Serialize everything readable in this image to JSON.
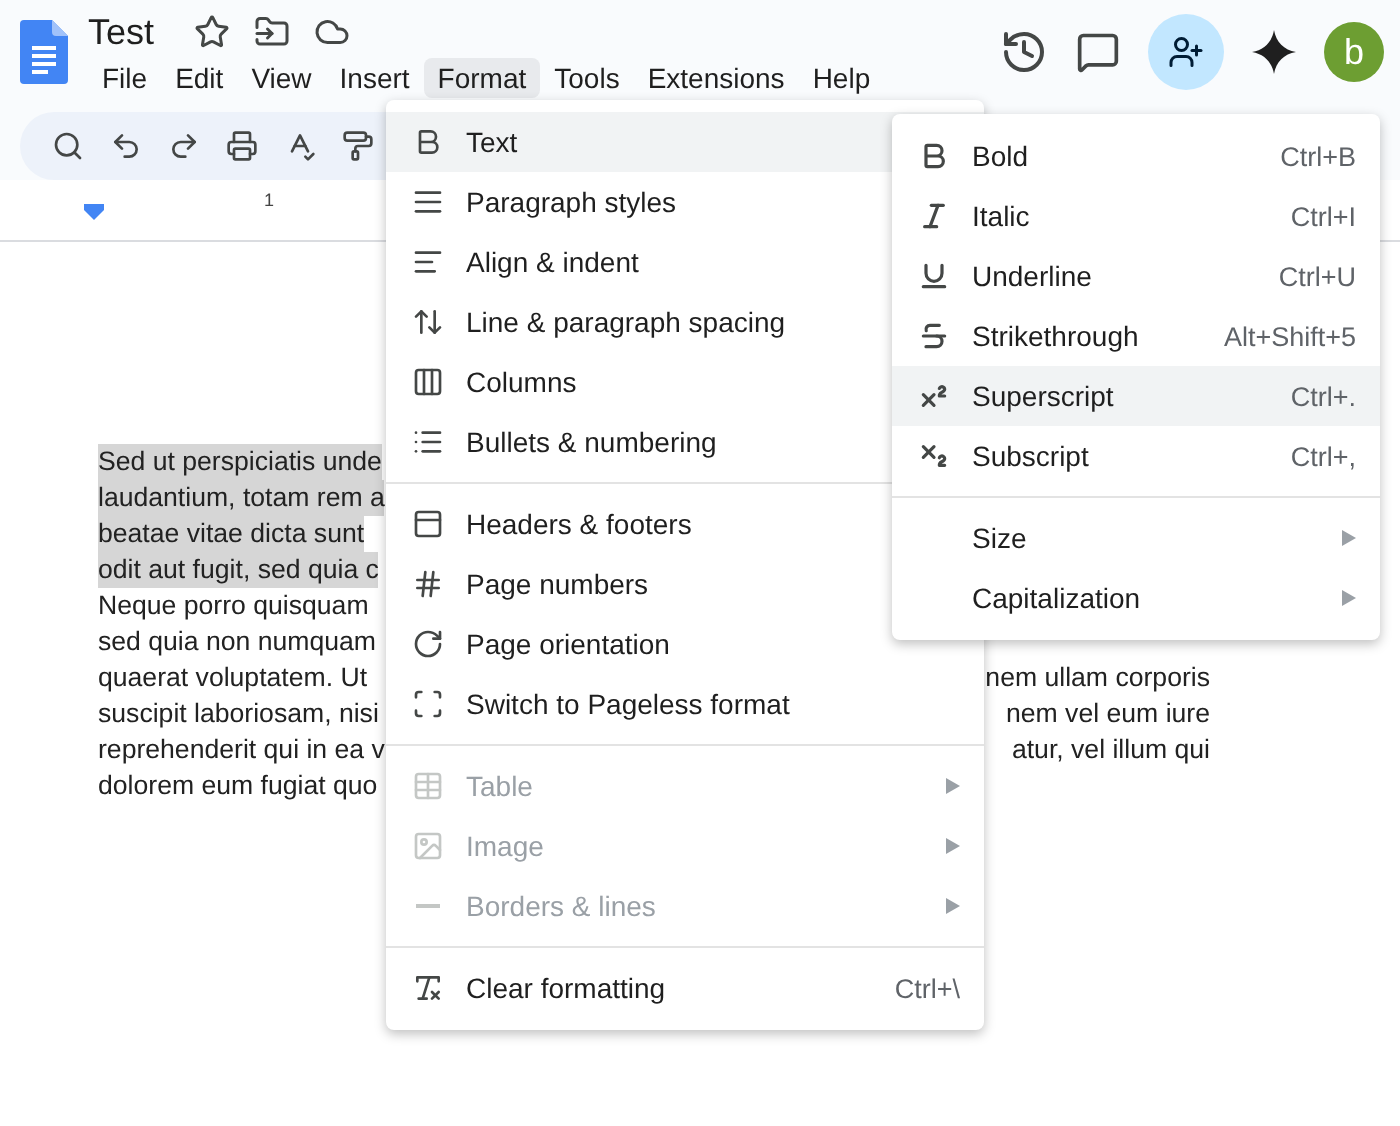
{
  "document": {
    "title": "Test",
    "avatar_letter": "b"
  },
  "menubar": [
    {
      "label": "File",
      "selected": false
    },
    {
      "label": "Edit",
      "selected": false
    },
    {
      "label": "View",
      "selected": false
    },
    {
      "label": "Insert",
      "selected": false
    },
    {
      "label": "Format",
      "selected": true
    },
    {
      "label": "Tools",
      "selected": false
    },
    {
      "label": "Extensions",
      "selected": false
    },
    {
      "label": "Help",
      "selected": false
    }
  ],
  "ruler": {
    "mark": "1"
  },
  "body_lines": [
    {
      "left": "Sed ut perspiciatis unde",
      "highlighted": true
    },
    {
      "left": "laudantium, totam rem a",
      "highlighted": true
    },
    {
      "left": "beatae vitae dicta sunt",
      "highlighted": true
    },
    {
      "left": "odit aut fugit, sed quia c",
      "highlighted": true
    },
    {
      "left": "Neque porro quisquam",
      "highlighted": false
    },
    {
      "left": "sed quia non numquam",
      "highlighted": false
    },
    {
      "left": "quaerat voluptatem. Ut",
      "right": "nem ullam corporis",
      "highlighted": false
    },
    {
      "left": "suscipit laboriosam, nisi",
      "right": "nem vel eum iure",
      "highlighted": false
    },
    {
      "left": "reprehenderit qui in ea v",
      "right": "atur, vel illum qui",
      "highlighted": false
    },
    {
      "left": "dolorem eum fugiat quo",
      "highlighted": false
    }
  ],
  "format_menu": {
    "sections": [
      [
        {
          "label": "Text",
          "highlighted": true,
          "disabled": false
        },
        {
          "label": "Paragraph styles",
          "highlighted": false,
          "disabled": false
        },
        {
          "label": "Align & indent",
          "highlighted": false,
          "disabled": false
        },
        {
          "label": "Line & paragraph spacing",
          "highlighted": false,
          "disabled": false
        },
        {
          "label": "Columns",
          "highlighted": false,
          "disabled": false
        },
        {
          "label": "Bullets & numbering",
          "highlighted": false,
          "disabled": false
        }
      ],
      [
        {
          "label": "Headers & footers",
          "highlighted": false,
          "disabled": false
        },
        {
          "label": "Page numbers",
          "highlighted": false,
          "disabled": false
        },
        {
          "label": "Page orientation",
          "highlighted": false,
          "disabled": false
        },
        {
          "label": "Switch to Pageless format",
          "highlighted": false,
          "disabled": false
        }
      ],
      [
        {
          "label": "Table",
          "highlighted": false,
          "disabled": true,
          "submenu": true
        },
        {
          "label": "Image",
          "highlighted": false,
          "disabled": true,
          "submenu": true
        },
        {
          "label": "Borders & lines",
          "highlighted": false,
          "disabled": true,
          "submenu": true
        }
      ],
      [
        {
          "label": "Clear formatting",
          "highlighted": false,
          "disabled": false,
          "shortcut": "Ctrl+\\"
        }
      ]
    ]
  },
  "text_submenu": {
    "sections": [
      [
        {
          "label": "Bold",
          "shortcut": "Ctrl+B",
          "highlighted": false
        },
        {
          "label": "Italic",
          "shortcut": "Ctrl+I",
          "highlighted": false
        },
        {
          "label": "Underline",
          "shortcut": "Ctrl+U",
          "highlighted": false
        },
        {
          "label": "Strikethrough",
          "shortcut": "Alt+Shift+5",
          "highlighted": false
        },
        {
          "label": "Superscript",
          "shortcut": "Ctrl+.",
          "highlighted": true
        },
        {
          "label": "Subscript",
          "shortcut": "Ctrl+,",
          "highlighted": false
        }
      ],
      [
        {
          "label": "Size",
          "highlighted": false,
          "submenu": true
        },
        {
          "label": "Capitalization",
          "highlighted": false,
          "submenu": true
        }
      ]
    ]
  }
}
